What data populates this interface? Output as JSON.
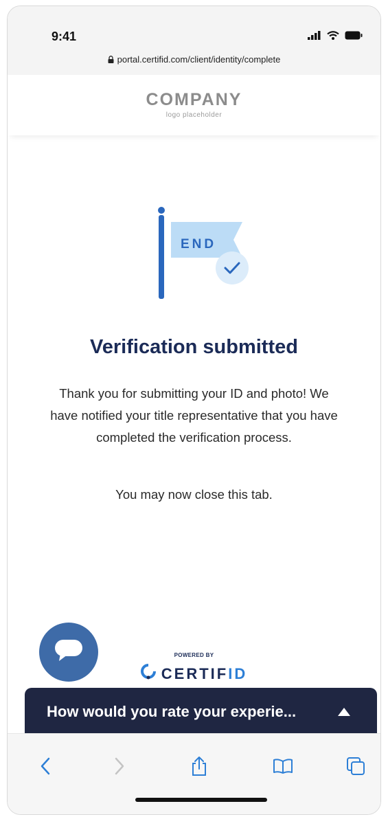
{
  "status_bar": {
    "time": "9:41"
  },
  "browser": {
    "url": "portal.certifid.com/client/identity/complete"
  },
  "company": {
    "name": "COMPANY",
    "subtitle": "logo placeholder"
  },
  "hero": {
    "flag_label": "END",
    "title": "Verification submitted",
    "message": "Thank you for submitting your ID and photo! We have notified your title representative that you have completed the verification process.",
    "close_message": "You may now close this tab."
  },
  "footer": {
    "powered_by": "POWERED BY",
    "brand_main": "CERTIF",
    "brand_accent": "ID"
  },
  "rating": {
    "prompt": "How would you rate your experie..."
  },
  "toolbar": {
    "icons": [
      "back-icon",
      "forward-icon",
      "share-icon",
      "bookmarks-icon",
      "tabs-icon"
    ]
  },
  "colors": {
    "accent_blue": "#2d7fd6",
    "navy": "#1b2b57",
    "chat_bubble": "#3e6ba8",
    "rating_bar": "#1f2642",
    "flag_light": "#bcdcf6"
  }
}
